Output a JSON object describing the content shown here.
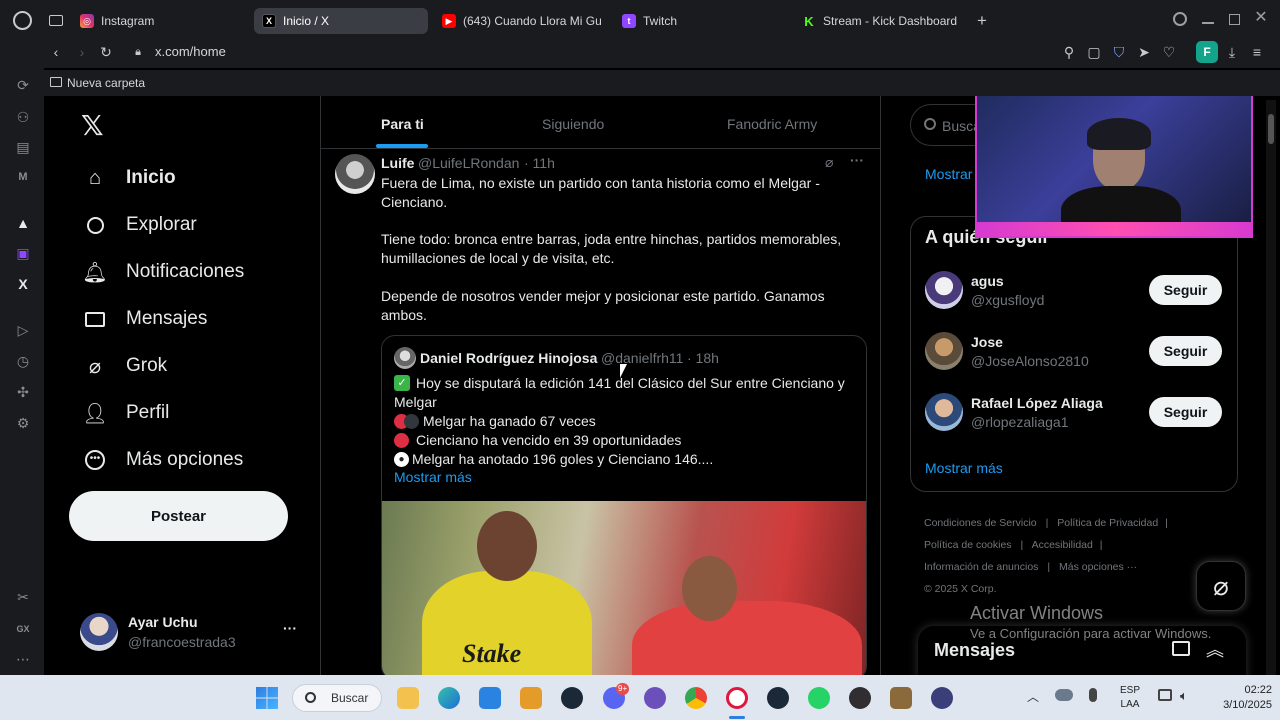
{
  "browser": {
    "tabs": [
      {
        "label": "Instagram",
        "icon": "instagram-icon",
        "color": "#e1306c"
      },
      {
        "label": "Inicio / X",
        "icon": "x-icon",
        "color": "#000000",
        "active": true
      },
      {
        "label": "(643) Cuando Llora Mi Gu",
        "icon": "youtube-icon",
        "color": "#ff0000"
      },
      {
        "label": "Twitch",
        "icon": "twitch-icon",
        "color": "#9146ff"
      },
      {
        "label": "Stream - Kick Dashboard",
        "icon": "kick-icon",
        "color": "#53fc18"
      }
    ],
    "url": "x.com/home",
    "bookmark_folder": "Nueva carpeta",
    "profile_initial": "F"
  },
  "nav": {
    "items": [
      {
        "label": "Inicio",
        "icon": "home-icon"
      },
      {
        "label": "Explorar",
        "icon": "search-icon"
      },
      {
        "label": "Notificaciones",
        "icon": "bell-icon"
      },
      {
        "label": "Mensajes",
        "icon": "mail-icon"
      },
      {
        "label": "Grok",
        "icon": "grok-icon"
      },
      {
        "label": "Perfil",
        "icon": "person-icon"
      },
      {
        "label": "Más opciones",
        "icon": "more-circle-icon"
      }
    ],
    "post_label": "Postear",
    "account": {
      "name": "Ayar Uchu",
      "handle": "@francoestrada3"
    }
  },
  "feed": {
    "tabs": [
      "Para ti",
      "Siguiendo",
      "Fanodric Army"
    ],
    "tweet": {
      "author": "Luife",
      "handle": "@LuifeLRondan",
      "time": "· 11h",
      "p1": "Fuera de Lima, no existe un partido con tanta historia como el Melgar - Cienciano.",
      "p2": "Tiene todo: bronca entre barras, joda entre hinchas, partidos memorables, humillaciones de local y de visita, etc.",
      "p3": "Depende de nosotros vender mejor y posicionar este partido. Ganamos ambos.",
      "quote": {
        "author": "Daniel Rodríguez Hinojosa",
        "handle": "@danielfrh11",
        "time": "· 18h",
        "l1": "Hoy se disputará la edición 141 del Clásico del Sur entre Cienciano y Melgar",
        "l2": "Melgar ha ganado 67 veces",
        "l3": "Cienciano ha vencido en 39 oportunidades",
        "l4": "Melgar ha anotado 196 goles y Cienciano 146....",
        "show_more": "Mostrar más",
        "image_text": "Stake"
      }
    }
  },
  "right": {
    "search_placeholder": "Busca",
    "show_more_top": "Mostrar",
    "who_to_follow_title": "A quién seguir",
    "suggestions": [
      {
        "name": "agus",
        "handle": "@xgusfloyd",
        "button": "Seguir"
      },
      {
        "name": "Jose",
        "handle": "@JoseAlonso2810",
        "button": "Seguir"
      },
      {
        "name": "Rafael López Aliaga",
        "handle": "@rlopezaliaga1",
        "button": "Seguir"
      }
    ],
    "show_more": "Mostrar más",
    "footer_links": [
      "Condiciones de Servicio",
      "Política de Privacidad",
      "Política de cookies",
      "Accesibilidad",
      "Información de anuncios",
      "Más opciones ···",
      "© 2025 X Corp."
    ],
    "messages_label": "Mensajes"
  },
  "windows": {
    "activate_title": "Activar Windows",
    "activate_sub": "Ve a Configuración para activar Windows.",
    "search_label": "Buscar",
    "lang1": "ESP",
    "lang2": "LAA",
    "time": "02:22",
    "date": "3/10/2025",
    "badge": "9+"
  }
}
